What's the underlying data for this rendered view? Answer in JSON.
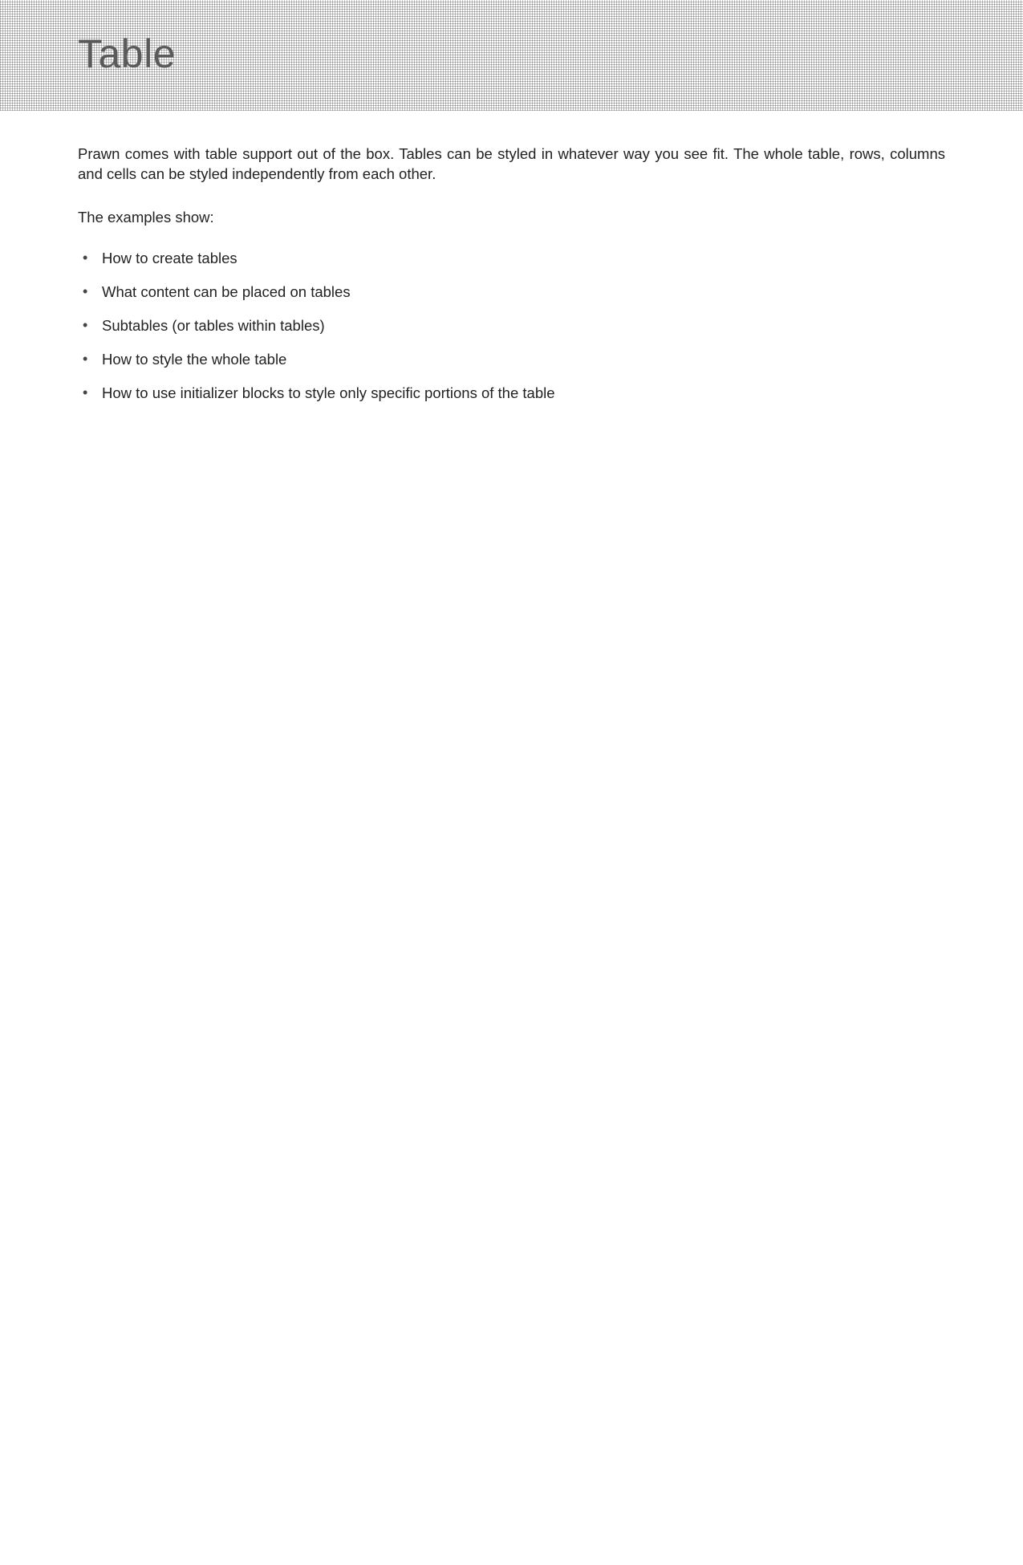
{
  "header": {
    "title": "Table"
  },
  "body": {
    "intro": "Prawn comes with table support out of the box. Tables can be styled in whatever way you see fit. The whole table, rows, columns and cells can be styled independently from each other.",
    "examples_label": "The examples show:",
    "bullets": [
      "How to create tables",
      "What content can be placed on tables",
      "Subtables (or tables within tables)",
      "How to style the whole table",
      "How to use initializer blocks to style only specific portions of the table"
    ]
  }
}
